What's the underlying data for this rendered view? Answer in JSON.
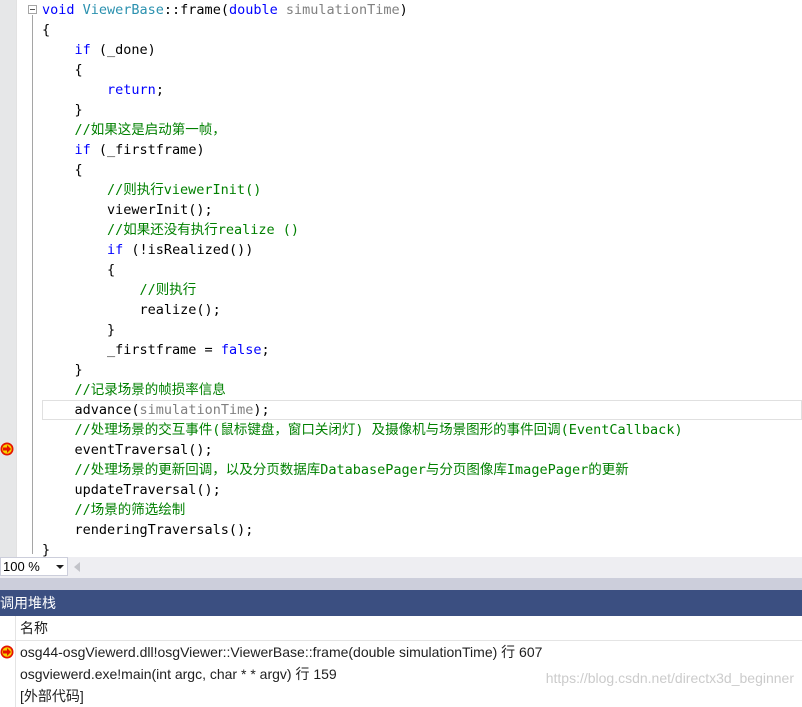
{
  "editor": {
    "lines": [
      [
        {
          "t": "void ",
          "c": "kw"
        },
        {
          "t": "ViewerBase",
          "c": "ty"
        },
        {
          "t": "::frame(",
          "c": ""
        },
        {
          "t": "double ",
          "c": "kw"
        },
        {
          "t": "simulationTime",
          "c": "pm"
        },
        {
          "t": ")",
          "c": ""
        }
      ],
      [
        {
          "t": "{",
          "c": ""
        }
      ],
      [
        {
          "t": "    ",
          "c": ""
        },
        {
          "t": "if",
          "c": "kw"
        },
        {
          "t": " (_done)",
          "c": ""
        }
      ],
      [
        {
          "t": "    {",
          "c": ""
        }
      ],
      [
        {
          "t": "        ",
          "c": ""
        },
        {
          "t": "return",
          "c": "kw"
        },
        {
          "t": ";",
          "c": ""
        }
      ],
      [
        {
          "t": "    }",
          "c": ""
        }
      ],
      [
        {
          "t": "    ",
          "c": ""
        },
        {
          "t": "//如果这是启动第一帧，",
          "c": "cm"
        }
      ],
      [
        {
          "t": "    ",
          "c": ""
        },
        {
          "t": "if",
          "c": "kw"
        },
        {
          "t": " (_firstframe)",
          "c": ""
        }
      ],
      [
        {
          "t": "    {",
          "c": ""
        }
      ],
      [
        {
          "t": "        ",
          "c": ""
        },
        {
          "t": "//则执行viewerInit()",
          "c": "cm"
        }
      ],
      [
        {
          "t": "        viewerInit();",
          "c": ""
        }
      ],
      [
        {
          "t": "        ",
          "c": ""
        },
        {
          "t": "//如果还没有执行realize ()",
          "c": "cm"
        }
      ],
      [
        {
          "t": "        ",
          "c": ""
        },
        {
          "t": "if",
          "c": "kw"
        },
        {
          "t": " (!isRealized())",
          "c": ""
        }
      ],
      [
        {
          "t": "        {",
          "c": ""
        }
      ],
      [
        {
          "t": "            ",
          "c": ""
        },
        {
          "t": "//则执行",
          "c": "cm"
        }
      ],
      [
        {
          "t": "            realize();",
          "c": ""
        }
      ],
      [
        {
          "t": "        }",
          "c": ""
        }
      ],
      [
        {
          "t": "        _firstframe = ",
          "c": ""
        },
        {
          "t": "false",
          "c": "kw"
        },
        {
          "t": ";",
          "c": ""
        }
      ],
      [
        {
          "t": "    }",
          "c": ""
        }
      ],
      [
        {
          "t": "    ",
          "c": ""
        },
        {
          "t": "//记录场景的帧损率信息",
          "c": "cm"
        }
      ],
      [
        {
          "t": "    advance(",
          "c": ""
        },
        {
          "t": "simulationTime",
          "c": "pm"
        },
        {
          "t": ");",
          "c": ""
        }
      ],
      [
        {
          "t": "    ",
          "c": ""
        },
        {
          "t": "//处理场景的交互事件(鼠标键盘，窗口关闭灯) 及摄像机与场景图形的事件回调(EventCallback)",
          "c": "cm"
        }
      ],
      [
        {
          "t": "    eventTraversal();",
          "c": ""
        }
      ],
      [
        {
          "t": "    ",
          "c": ""
        },
        {
          "t": "//处理场景的更新回调，以及分页数据库DatabasePager与分页图像库ImagePager的更新",
          "c": "cm"
        }
      ],
      [
        {
          "t": "    updateTraversal();",
          "c": ""
        }
      ],
      [
        {
          "t": "    ",
          "c": ""
        },
        {
          "t": "//场景的筛选绘制",
          "c": "cm"
        }
      ],
      [
        {
          "t": "    renderingTraversals();",
          "c": ""
        }
      ],
      [
        {
          "t": "}",
          "c": ""
        }
      ]
    ],
    "current_line_index": 20,
    "breakpoint_line_index": 22
  },
  "zoom": {
    "value": "100 %"
  },
  "call_stack": {
    "title": "调用堆栈",
    "column_name": "名称",
    "rows": [
      "osg44-osgViewerd.dll!osgViewer::ViewerBase::frame(double simulationTime) 行 607",
      "osgviewerd.exe!main(int argc, char * * argv) 行 159",
      "[外部代码]"
    ]
  },
  "watermark": "https://blog.csdn.net/directx3d_beginner",
  "colors": {
    "keyword": "#0000ff",
    "comment": "#008000",
    "type": "#2b91af",
    "param": "#808080",
    "panel_title": "#3b4f81"
  }
}
